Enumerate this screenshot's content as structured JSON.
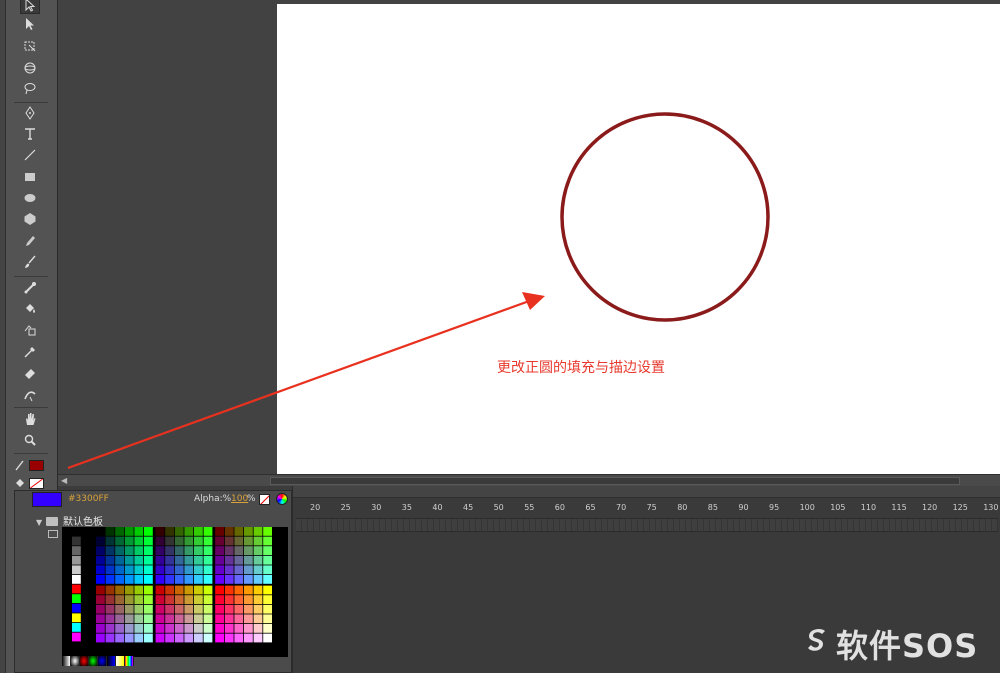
{
  "annotation": "更改正圆的填充与描边设置",
  "stroke_color": "#990000",
  "circle_stroke": "#8b1a1a",
  "arrow_color": "#e8311f",
  "swatches": {
    "current_color": "#3300FF",
    "hex_label": "#3300FF",
    "alpha_label": "Alpha:%",
    "alpha_value": "100",
    "alpha_unit": "%",
    "folder_name": "默认色板"
  },
  "timeline": {
    "frame_labels": [
      "20",
      "25",
      "30",
      "35",
      "40",
      "45",
      "50",
      "55",
      "60",
      "65",
      "70",
      "75",
      "80",
      "85",
      "90",
      "95",
      "100",
      "105",
      "110",
      "115",
      "120",
      "125",
      "130"
    ]
  },
  "watermark": "软件SOS",
  "tools": [
    "selection-icon",
    "subselection-icon",
    "free-transform-icon",
    "3d-rotation-icon",
    "lasso-icon",
    "pen-icon",
    "text-icon",
    "line-icon",
    "rectangle-icon",
    "oval-icon",
    "polystar-icon",
    "pencil-icon",
    "brush-icon",
    "bone-icon",
    "paint-bucket-icon",
    "ink-bottle-icon",
    "eyedropper-icon",
    "eraser-icon",
    "width-icon",
    "hand-icon",
    "zoom-icon"
  ]
}
